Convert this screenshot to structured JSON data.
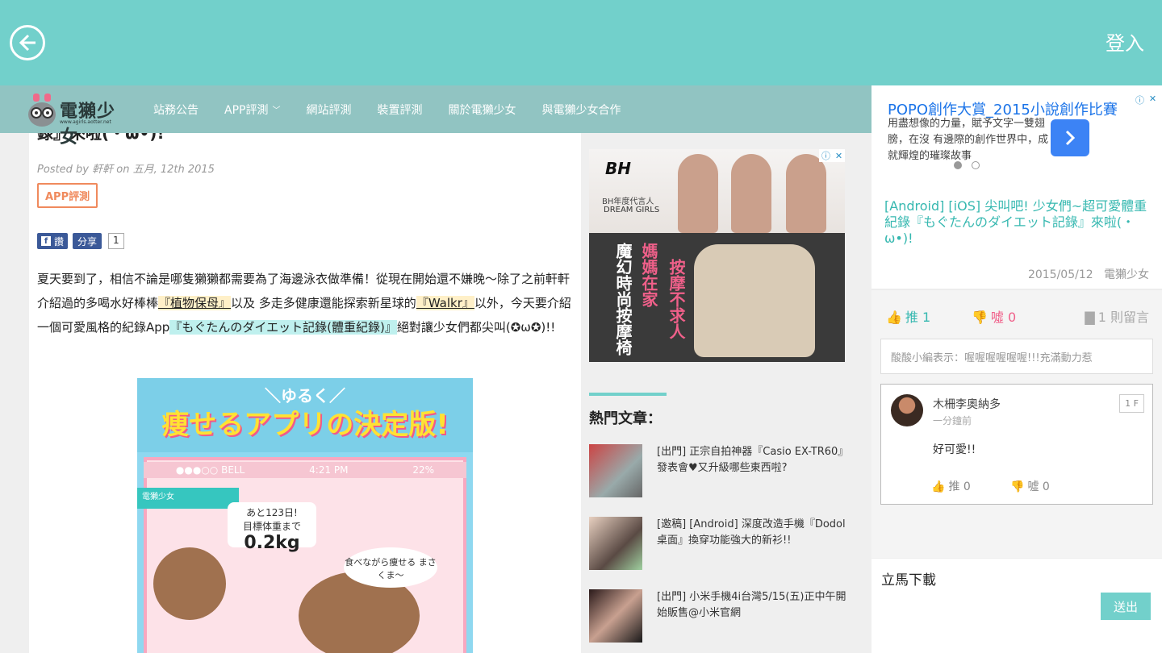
{
  "topbar": {
    "login_label": "登入"
  },
  "site": {
    "logo_text": "電獺少女",
    "logo_sub": "www.agirls.aotter.net",
    "nav": [
      {
        "label": "站務公告"
      },
      {
        "label": "APP評測"
      },
      {
        "label": "網站評測"
      },
      {
        "label": "裝置評測"
      },
      {
        "label": "關於電獺少女"
      },
      {
        "label": "與電獺少女合作"
      }
    ]
  },
  "article": {
    "title_fragment": "錄』來啦(・ω•)!",
    "meta": "Posted by 軒軒 on 五月, 12th 2015",
    "category": "APP評測",
    "fb_label": "讚",
    "share_label": "分享",
    "share_count": "1",
    "body": {
      "p1": "夏天要到了，相信不論是哪隻獺獺都需要為了海邊泳衣做準備！從現在開始還不嫌晚～除了之前軒軒介紹過的多喝水好棒棒",
      "link1": "『植物保母』",
      "p2": "以及 多走多健康還能探索新星球的",
      "link2": "『Walkr』",
      "p3": "以外，今天要介紹一個可愛風格的紀錄App",
      "link3": "『もぐたんのダイエット記錄(體重紀錄)』",
      "p4": "絕對讓少女們都尖叫(✪ω✪)!!"
    },
    "image": {
      "line1": "＼ゆるく／",
      "line2": "痩せるアプリの決定版!",
      "status_carrier": "●●●○○ BELL",
      "status_time": "4:21 PM",
      "status_battery": "22%",
      "watermark": "電獺少女",
      "countdown": "あと123日!",
      "target": "目標体重まで",
      "target_value": "0.2kg",
      "bubble": "食べながら痩せる まさくま～"
    }
  },
  "ad": {
    "brand": "BH",
    "line1": "BH年度代言人",
    "line2": "DREAM GIRLS",
    "vert1": "魔幻時尚按摩椅",
    "vert2": "媽媽在家",
    "vert3": "按摩不求人"
  },
  "hot": {
    "title": "熱門文章：",
    "items": [
      {
        "text": "[出門] 正宗自拍神器『Casio EX-TR60』發表會♥又升級哪些東西啦?"
      },
      {
        "text": "[邀稿] [Android] 深度改造手機『Dodol桌面』換穿功能強大的新衫!!"
      },
      {
        "text": "[出門] 小米手機4i台灣5/15(五)正中午開始販售@小米官網"
      }
    ]
  },
  "panel": {
    "ad_title": "POPO創作大賞_2015小說創作比賽",
    "ad_text": "用盡想像的力量，賦予文字一雙翅膀，在沒 有邊際的創作世界中，成就輝煌的璀璨故事",
    "article_title": "[Android] [iOS] 尖叫吧! 少女們~超可愛體重紀錄『もぐたんのダイエット記錄』來啦(・ω•)!",
    "date": "2015/05/12",
    "author": "電獺少女",
    "like_label": "推 1",
    "boo_label": "噓 0",
    "comment_count": "1 則留言",
    "notice": "酸酸小編表示：喔喔喔喔喔喔!!!充滿動力惹",
    "comment": {
      "name": "木柵李奧納多",
      "time": "一分鐘前",
      "floor": "1 F",
      "text": "好可愛!!",
      "like": "推 0",
      "boo": "噓 0"
    },
    "input_value": "立馬下載",
    "send_label": "送出"
  },
  "colors": {
    "accent": "#72d0cb",
    "nav": "#91c4c2",
    "link": "#36b8b0",
    "boo": "#f0608a"
  }
}
